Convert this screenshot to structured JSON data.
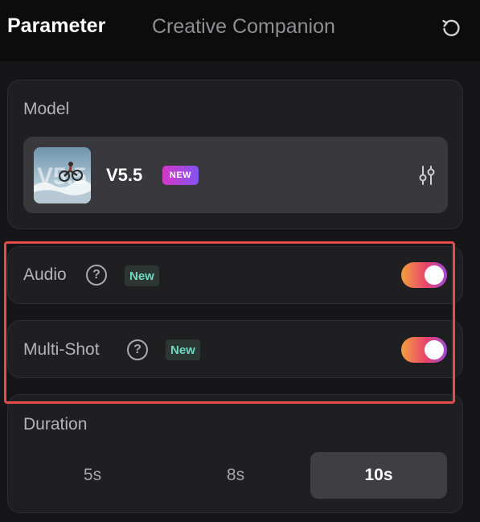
{
  "header": {
    "tabs": [
      {
        "label": "Parameter",
        "active": true
      },
      {
        "label": "Creative Companion",
        "active": false
      }
    ],
    "reset_icon": "reset-icon"
  },
  "model": {
    "section_label": "Model",
    "name": "V5.5",
    "badge": "NEW",
    "thumbnail_icon": "model-thumbnail",
    "settings_icon": "sliders-icon"
  },
  "audio": {
    "label": "Audio",
    "help_icon": "question-icon",
    "help_glyph": "?",
    "tag": "New",
    "enabled": true
  },
  "multishot": {
    "label": "Multi-Shot",
    "help_icon": "question-icon",
    "help_glyph": "?",
    "tag": "New",
    "enabled": true
  },
  "duration": {
    "section_label": "Duration",
    "options": [
      {
        "label": "5s",
        "selected": false
      },
      {
        "label": "8s",
        "selected": false
      },
      {
        "label": "10s",
        "selected": true
      }
    ]
  },
  "colors": {
    "background": "#161618",
    "card": "#1f1f22",
    "accent_gradient": [
      "#f2a03f",
      "#e9436c",
      "#9f49d8"
    ],
    "highlight": "#e54b4b",
    "new_tag_text": "#6fd8bf"
  }
}
